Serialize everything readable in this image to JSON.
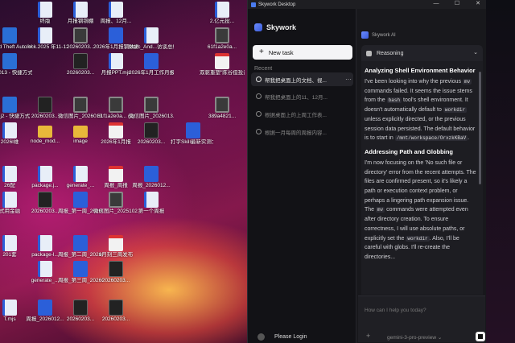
{
  "desktop": {
    "icons": [
      {
        "label": "终版",
        "type": "doc"
      },
      {
        "label": "月报钢铜棚",
        "type": "doc"
      },
      {
        "label": "周报、12月...",
        "type": "doc"
      },
      {
        "label": "2.亿元投...",
        "type": "doc"
      },
      {
        "label": "Grand Theft Auto Vice ...",
        "type": "app"
      },
      {
        "label": "...lock.2025 年11-12月...",
        "type": "doc"
      },
      {
        "label": "20260203...",
        "type": "img"
      },
      {
        "label": "2026年1月报钢数据",
        "type": "word"
      },
      {
        "label": "Marc_And...访谈总结与...",
        "type": "doc"
      },
      {
        "label": "61f1a2e0a...",
        "type": "img"
      },
      {
        "label": "pes2013 - 快捷方式",
        "type": "app"
      },
      {
        "label": "20260203...",
        "type": "exe"
      },
      {
        "label": "月报PPT.mjs",
        "type": "doc"
      },
      {
        "label": "2026年1月工作月报",
        "type": "word"
      },
      {
        "label": "双驱重塑\"陈谷但投资义...",
        "type": "pdf"
      },
      {
        "label": "igsmj2 - 快捷方式",
        "type": "app"
      },
      {
        "label": "20260203...",
        "type": "exe"
      },
      {
        "label": "微信图片_2026013...",
        "type": "img"
      },
      {
        "label": "61f1a2e0a... (1)",
        "type": "img"
      },
      {
        "label": "微信图片_2026013...",
        "type": "img"
      },
      {
        "label": "389a4821...",
        "type": "img"
      },
      {
        "label": "2026l维",
        "type": "doc"
      },
      {
        "label": "node_mod...",
        "type": "folder"
      },
      {
        "label": "image",
        "type": "folder"
      },
      {
        "label": "2026年1月报",
        "type": "pdf"
      },
      {
        "label": "20260203...",
        "type": "exe"
      },
      {
        "label": "打字Skill最新实测：一键...",
        "type": "word"
      },
      {
        "label": "26配",
        "type": "doc"
      },
      {
        "label": "package.j...",
        "type": "doc"
      },
      {
        "label": "generate_...",
        "type": "doc"
      },
      {
        "label": "周报_周报",
        "type": "pdf"
      },
      {
        "label": "周报_2026012...",
        "type": "word"
      },
      {
        "label": "式用金融",
        "type": "doc"
      },
      {
        "label": "20260203...",
        "type": "exe"
      },
      {
        "label": "周报_第一周_2026010...",
        "type": "word"
      },
      {
        "label": "微信图片_2025102...",
        "type": "img"
      },
      {
        "label": "第一个周报",
        "type": "doc"
      },
      {
        "label": "201套",
        "type": "doc"
      },
      {
        "label": "package-l...",
        "type": "doc"
      },
      {
        "label": "周报_第二周_2026012...",
        "type": "word"
      },
      {
        "label": "1月刻三周发布",
        "type": "pdf"
      },
      {
        "label": "generate_...",
        "type": "doc"
      },
      {
        "label": "周报_第三周_2026012...",
        "type": "word"
      },
      {
        "label": "20260203...",
        "type": "exe"
      },
      {
        "label": "T.mjs",
        "type": "doc"
      },
      {
        "label": "周报_2026012...",
        "type": "word"
      },
      {
        "label": "20260203...",
        "type": "exe"
      },
      {
        "label": "20260203...",
        "type": "exe"
      }
    ]
  },
  "window": {
    "title": "Skywork Desktop",
    "controls": {
      "minimize": "—",
      "maximize": "☐",
      "close": "✕"
    }
  },
  "sidebar": {
    "brand": "Skywork",
    "new_task": "New task",
    "recent_label": "Recent",
    "tasks": [
      {
        "label": "帮我把桌面上的文档、视..."
      },
      {
        "label": "帮我把桌面上的11、12月..."
      },
      {
        "label": "根据桌面上的上周工作表..."
      },
      {
        "label": "根据一月每周的周报内容..."
      }
    ],
    "more": "···",
    "login": "Please Login"
  },
  "main": {
    "assistant_name": "Skywork AI",
    "reasoning_label": "Reasoning",
    "sections": [
      {
        "heading": "Analyzing Shell Environment Behavior",
        "p1": "I've been looking into why the previous",
        "c1": "mv",
        "p2": "commands failed. It seems the issue stems from the",
        "c2": "bash",
        "p3": "tool's shell environment. It doesn't automatically default to",
        "c3": "workdir",
        "p4": "unless explicitly directed, or the previous session data persisted. The default behavior is to start in",
        "c4": "/mnt/workspace/OrxzkKBaV",
        "p5": "."
      },
      {
        "heading": "Addressing Path and Globbing",
        "p1": "I'm now focusing on the 'No such file or directory' error from the recent attempts. The files are confirmed present, so it's likely a path or execution context problem, or perhaps a lingering path expansion issue. The",
        "c1": "mv",
        "p2": "commands were attempted even after directory creation. To ensure correctness, I will use absolute paths, or explicitly set the",
        "c2": "workdir",
        "p3": ". Also, I'll be careful with globs. I'll re-create the directories..."
      }
    ],
    "input_placeholder": "How can I help you today?",
    "add": "+",
    "model": "gemini-3-pro-preview"
  }
}
